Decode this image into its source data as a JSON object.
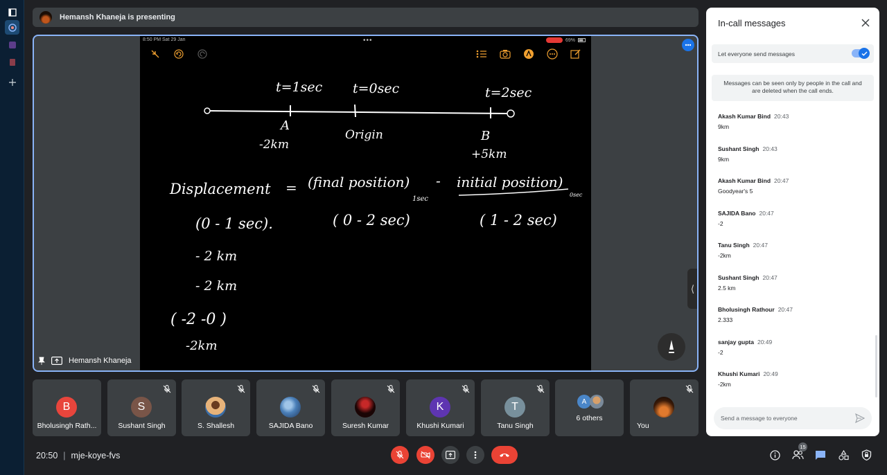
{
  "presenting": {
    "text": "Hemansh Khaneja is presenting"
  },
  "stage": {
    "presenter_label": "Hemansh Khaneja",
    "device_status": {
      "time": "8:50 PM  Sat 29 Jan",
      "battery": "69%"
    },
    "whiteboard": {
      "t_labels": [
        "t=1sec",
        "t=0sec",
        "t=2sec"
      ],
      "point_labels": [
        "A",
        "Origin",
        "B"
      ],
      "positions": [
        "-2km",
        "+5km"
      ],
      "formula_left": "Displacement",
      "formula_eq": "=",
      "formula_final": "(final position)",
      "formula_minus": "-",
      "formula_initial": "initial position)",
      "sub_final": "1sec",
      "sub_initial": "0sec",
      "intervals": [
        "(0 - 1 sec).",
        "( 0 - 2 sec)",
        "( 1 - 2 sec)"
      ],
      "work": [
        "- 2 km",
        "- 2 km",
        "( -2 -0 )",
        "-2km"
      ]
    }
  },
  "participants": [
    {
      "name": "Bholusingh Rath...",
      "initial": "B",
      "color": "#e8453c",
      "muted": false
    },
    {
      "name": "Sushant Singh",
      "initial": "S",
      "color": "#795548",
      "muted": true
    },
    {
      "name": "S. Shallesh",
      "initial": "",
      "color": "#d9a066",
      "muted": true
    },
    {
      "name": "SAJIDA Bano",
      "initial": "",
      "color": "#4a7fb8",
      "muted": true
    },
    {
      "name": "Suresh Kumar",
      "initial": "",
      "color": "#2a0a0a",
      "muted": true
    },
    {
      "name": "Khushi Kumari",
      "initial": "K",
      "color": "#5e35b1",
      "muted": true
    },
    {
      "name": "Tanu Singh",
      "initial": "T",
      "color": "#78909c",
      "muted": true
    },
    {
      "name": "6 others",
      "initial": "A",
      "color": "#4a86c8",
      "muted": false
    },
    {
      "name": "You",
      "initial": "",
      "color": "#c0561c",
      "muted": true
    }
  ],
  "bottom": {
    "time": "20:50",
    "separator": "|",
    "meeting_code": "mje-koye-fvs",
    "people_count": "15"
  },
  "panel": {
    "title": "In-call messages",
    "toggle_label": "Let everyone send messages",
    "toggle_on": true,
    "notice": "Messages can be seen only by people in the call and are deleted when the call ends.",
    "input_placeholder": "Send a message to everyone",
    "messages": [
      {
        "sender": "Akash Kumar Bind",
        "time": "20:43",
        "text": "9km"
      },
      {
        "sender": "Sushant Singh",
        "time": "20:43",
        "text": "9km"
      },
      {
        "sender": "Akash Kumar Bind",
        "time": "20:47",
        "text": "Goodyear's 5"
      },
      {
        "sender": "SAJIDA Bano",
        "time": "20:47",
        "text": "-2"
      },
      {
        "sender": "Tanu Singh",
        "time": "20:47",
        "text": "-2km"
      },
      {
        "sender": "Sushant Singh",
        "time": "20:47",
        "text": "2.5 km"
      },
      {
        "sender": "Bholusingh Rathour",
        "time": "20:47",
        "text": "2.333"
      },
      {
        "sender": "sanjay gupta",
        "time": "20:49",
        "text": "-2"
      },
      {
        "sender": "Khushi Kumari",
        "time": "20:49",
        "text": "-2km"
      }
    ]
  }
}
